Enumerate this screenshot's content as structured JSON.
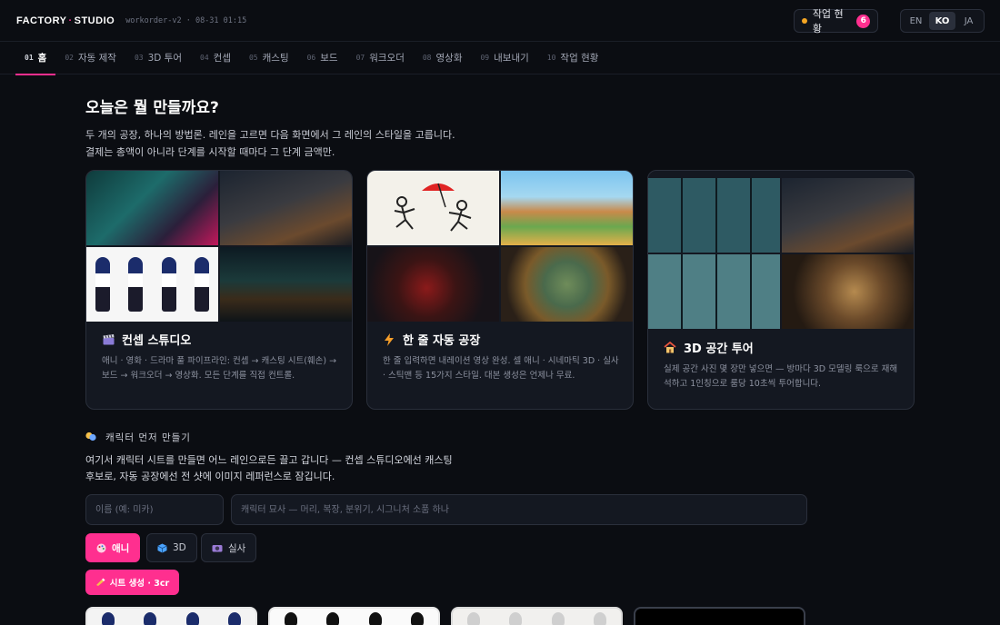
{
  "header": {
    "brand_left": "FACTORY",
    "brand_sep": "·",
    "brand_right": "STUDIO",
    "meta": "workorder-v2 · 08-31 01:15",
    "status_label": "작업 현황",
    "status_count": "6",
    "languages": [
      "EN",
      "KO",
      "JA"
    ],
    "active_language": "KO"
  },
  "tabs": [
    {
      "num": "01",
      "label": "홈",
      "active": true
    },
    {
      "num": "02",
      "label": "자동 제작"
    },
    {
      "num": "03",
      "label": "3D 투어"
    },
    {
      "num": "04",
      "label": "컨셉"
    },
    {
      "num": "05",
      "label": "캐스팅"
    },
    {
      "num": "06",
      "label": "보드"
    },
    {
      "num": "07",
      "label": "워크오더"
    },
    {
      "num": "08",
      "label": "영상화"
    },
    {
      "num": "09",
      "label": "내보내기"
    },
    {
      "num": "10",
      "label": "작업 현황"
    }
  ],
  "hero": {
    "title": "오늘은 뭘 만들까요?",
    "line1": "두 개의 공장, 하나의 방법론. 레인을 고르면 다음 화면에서 그 레인의 스타일을 고릅니다.",
    "line2": "결제는 총액이 아니라 단계를 시작할 때마다 그 단계 금액만."
  },
  "cards": [
    {
      "icon": "clapperboard-icon",
      "title": "컨셉 스튜디오",
      "desc": "애니 · 영화 · 드라마 풀 파이프라인: 컨셉 → 캐스팅 시트(훼손) → 보드 → 워크오더 → 영상화. 모든 단계를 직접 컨트롤."
    },
    {
      "icon": "lightning-icon",
      "title": "한 줄 자동 공장",
      "desc": "한 줄 입력하면 내레이션 영상 완성. 셀 애니 · 시네마틱 3D · 실사 · 스틱맨 등 15가지 스타일. 대본 생성은 언제나 무료."
    },
    {
      "icon": "house-icon",
      "title": "3D 공간 투어",
      "desc": "실제 공간 사진 몇 장만 넣으면 — 방마다 3D 모델링 룩으로 재해석하고 1인칭으로 룸당 10초씩 투어합니다."
    }
  ],
  "character": {
    "label": "캐릭터 먼저 만들기",
    "line1": "여기서 캐릭터 시트를 만들면 어느 레인으로든 끌고 갑니다 — 컨셉 스튜디오에선 캐스팅",
    "line2": "후보로, 자동 공장에선 전 샷에 이미지 레퍼런스로 잠깁니다.",
    "name_placeholder": "이름 (예: 미카)",
    "desc_placeholder": "캐릭터 묘사 — 머리, 복장, 분위기, 시그니처 소품 하나",
    "styles": [
      {
        "label": "애니",
        "icon": "palette-icon",
        "active": true
      },
      {
        "label": "3D",
        "icon": "cube-icon"
      },
      {
        "label": "실사",
        "icon": "camera-icon"
      }
    ],
    "generate_label": "시트 생성 · 3cr"
  },
  "colors": {
    "accent": "#ff2f8f",
    "status_dot": "#f5a623"
  }
}
